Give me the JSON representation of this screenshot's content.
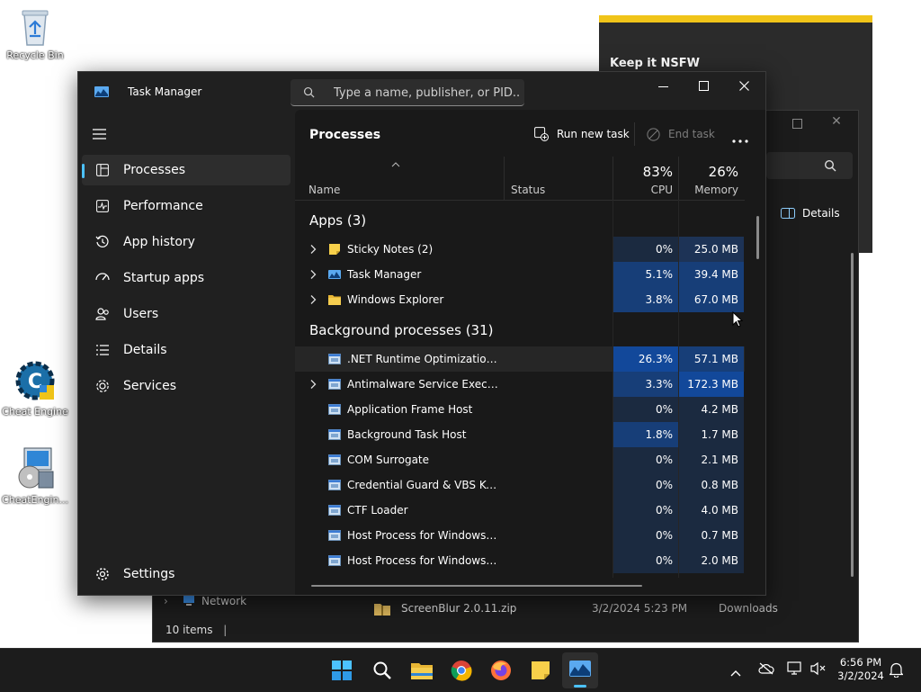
{
  "desktop": {
    "icons": [
      {
        "label": "Recycle Bin"
      },
      {
        "label": "Cheat Engine"
      },
      {
        "label": "CheatEngin..."
      }
    ]
  },
  "background_popup": {
    "title": "Keep it NSFW"
  },
  "explorer": {
    "details_label": "Details",
    "nav_network": "Network",
    "file_name": "ScreenBlur 2.0.11.zip",
    "file_date": "3/2/2024 5:23 PM",
    "file_location": "Downloads",
    "status": "10 items"
  },
  "task_manager": {
    "title": "Task Manager",
    "search_placeholder": "Type a name, publisher, or PID...",
    "nav": [
      {
        "label": "Processes",
        "icon": "processes-icon",
        "active": true
      },
      {
        "label": "Performance",
        "icon": "performance-icon"
      },
      {
        "label": "App history",
        "icon": "app-history-icon"
      },
      {
        "label": "Startup apps",
        "icon": "startup-apps-icon"
      },
      {
        "label": "Users",
        "icon": "users-icon"
      },
      {
        "label": "Details",
        "icon": "details-icon"
      },
      {
        "label": "Services",
        "icon": "services-icon"
      }
    ],
    "settings_label": "Settings",
    "page_title": "Processes",
    "run_new_task": "Run new task",
    "end_task": "End task",
    "columns": {
      "name": "Name",
      "status": "Status",
      "cpu_total": "83%",
      "cpu": "CPU",
      "memory_total": "26%",
      "memory": "Memory"
    },
    "apps_header": "Apps (3)",
    "apps": [
      {
        "name": "Sticky Notes (2)",
        "cpu": "0%",
        "mem": "25.0 MB",
        "expandable": true,
        "cpu_level": 0,
        "mem_level": 1
      },
      {
        "name": "Task Manager",
        "cpu": "5.1%",
        "mem": "39.4 MB",
        "expandable": true,
        "cpu_level": 2,
        "mem_level": 2
      },
      {
        "name": "Windows Explorer",
        "cpu": "3.8%",
        "mem": "67.0 MB",
        "expandable": true,
        "cpu_level": 2,
        "mem_level": 2
      }
    ],
    "bg_header": "Background processes (31)",
    "background": [
      {
        "name": ".NET Runtime Optimization Se...",
        "cpu": "26.3%",
        "mem": "57.1 MB",
        "expandable": false,
        "cpu_level": 3,
        "mem_level": 2
      },
      {
        "name": "Antimalware Service Executable",
        "cpu": "3.3%",
        "mem": "172.3 MB",
        "expandable": true,
        "cpu_level": 2,
        "mem_level": 3
      },
      {
        "name": "Application Frame Host",
        "cpu": "0%",
        "mem": "4.2 MB",
        "expandable": false,
        "cpu_level": 0,
        "mem_level": 0
      },
      {
        "name": "Background Task Host",
        "cpu": "1.8%",
        "mem": "1.7 MB",
        "expandable": false,
        "cpu_level": 2,
        "mem_level": 0
      },
      {
        "name": "COM Surrogate",
        "cpu": "0%",
        "mem": "2.1 MB",
        "expandable": false,
        "cpu_level": 0,
        "mem_level": 0
      },
      {
        "name": "Credential Guard & VBS Key Is...",
        "cpu": "0%",
        "mem": "0.8 MB",
        "expandable": false,
        "cpu_level": 0,
        "mem_level": 0
      },
      {
        "name": "CTF Loader",
        "cpu": "0%",
        "mem": "4.0 MB",
        "expandable": false,
        "cpu_level": 0,
        "mem_level": 0
      },
      {
        "name": "Host Process for Windows Tasks",
        "cpu": "0%",
        "mem": "0.7 MB",
        "expandable": false,
        "cpu_level": 0,
        "mem_level": 0
      },
      {
        "name": "Host Process for Windows Tasks",
        "cpu": "0%",
        "mem": "2.0 MB",
        "expandable": false,
        "cpu_level": 0,
        "mem_level": 0
      }
    ]
  },
  "taskbar": {
    "time": "6:56 PM",
    "date": "3/2/2024"
  },
  "colors": {
    "heat_0": "#1b2a40",
    "heat_1": "#1d3356",
    "heat_2": "#173e78",
    "heat_3": "#12489a",
    "accent": "#4cc2ff"
  }
}
